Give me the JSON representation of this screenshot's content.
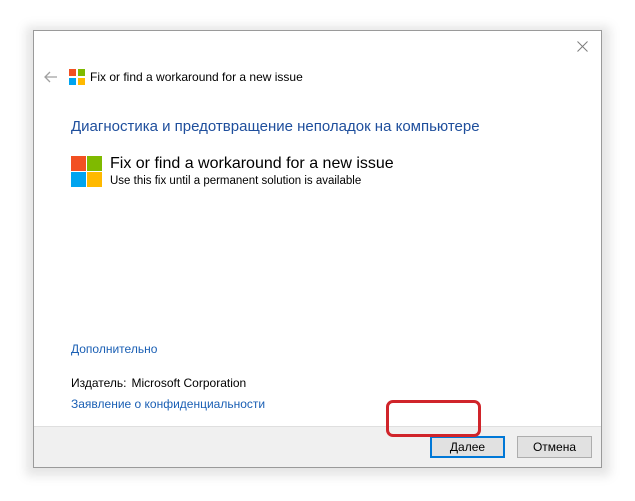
{
  "window": {
    "header_title": "Fix or find a workaround for a new issue",
    "close_glyph": "✕"
  },
  "main": {
    "heading": "Диагностика и предотвращение неполадок на компьютере",
    "option": {
      "title": "Fix or find a workaround for a new issue",
      "description": "Use this fix until a permanent solution is available"
    },
    "advanced_link": "Дополнительно",
    "publisher_label": "Издатель:",
    "publisher_value": "Microsoft Corporation",
    "privacy_link": "Заявление о конфиденциальности"
  },
  "footer": {
    "next_label": "Далее",
    "cancel_label": "Отмена"
  },
  "icons": {
    "back": "back-arrow-icon",
    "logo": "microsoft-logo-icon",
    "close": "close-icon"
  },
  "colors": {
    "heading": "#1e4e9c",
    "link": "#1a5fb4",
    "highlight": "#d0242a",
    "logo_red": "#f25022",
    "logo_green": "#7fba00",
    "logo_blue": "#00a4ef",
    "logo_yellow": "#ffb900"
  }
}
